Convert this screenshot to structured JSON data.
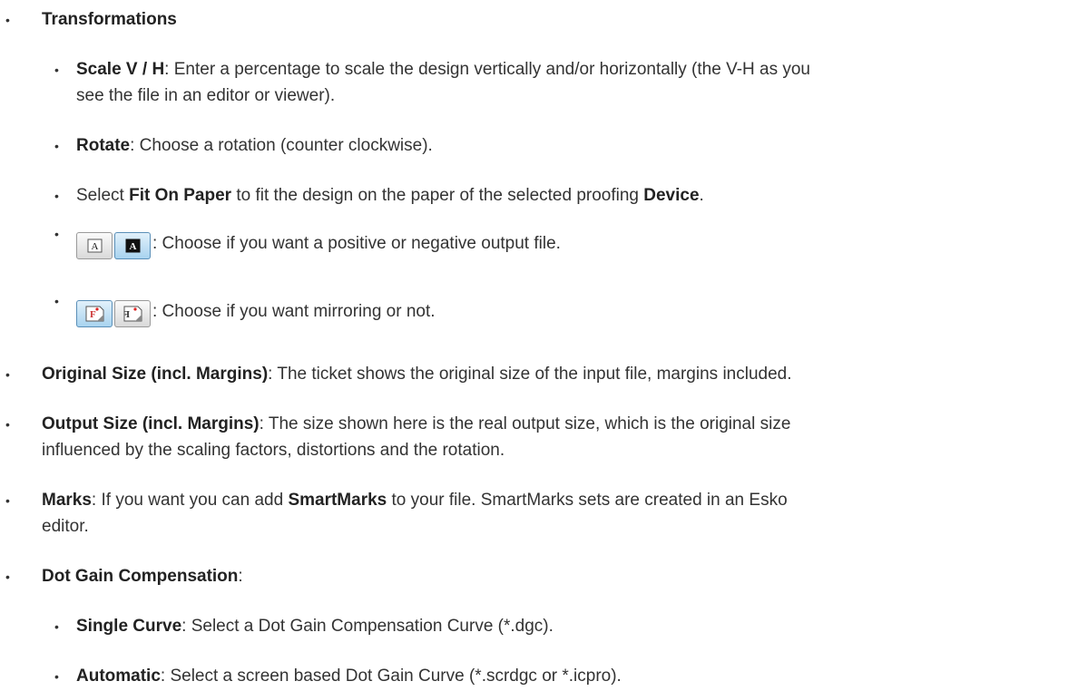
{
  "items": [
    {
      "bold": "Transformations",
      "text": ""
    },
    {
      "bold": "Scale V / H",
      "text": ": Enter a percentage to scale the design vertically and/or horizontally (the V-H as you",
      "cont": "see the file in an editor or viewer)."
    },
    {
      "bold": "Rotate",
      "text": ": Choose a rotation (counter clockwise)."
    },
    {
      "pre": "Select ",
      "bold": "Fit On Paper",
      "mid": " to fit the design on the paper of the selected proofing ",
      "bold2": "Device",
      "post": "."
    },
    {
      "text": ": Choose if you want a positive or negative output file."
    },
    {
      "text": ": Choose if you want mirroring or not."
    },
    {
      "bold": "Original Size (incl. Margins)",
      "text": ": The ticket shows the original size of the input file, margins included."
    },
    {
      "bold": "Output Size (incl. Margins)",
      "text": ": The size shown here is the real output size, which is the original size",
      "cont": "influenced by the scaling factors, distortions and the rotation."
    },
    {
      "bold": "Marks",
      "text": ": If you want you can add ",
      "bold2": "SmartMarks",
      "post": " to your file. SmartMarks sets are created in an Esko",
      "cont": "editor."
    },
    {
      "bold": "Dot Gain Compensation",
      "text": ":"
    },
    {
      "bold": "Single Curve",
      "text": ": Select a Dot Gain Compensation Curve (*.dgc)."
    },
    {
      "bold": "Automatic",
      "text": ": Select a screen based Dot Gain Curve (*.scrdgc or *.icpro)."
    }
  ],
  "bullet": "•",
  "icons": {
    "positive": "A",
    "negative": "A"
  }
}
